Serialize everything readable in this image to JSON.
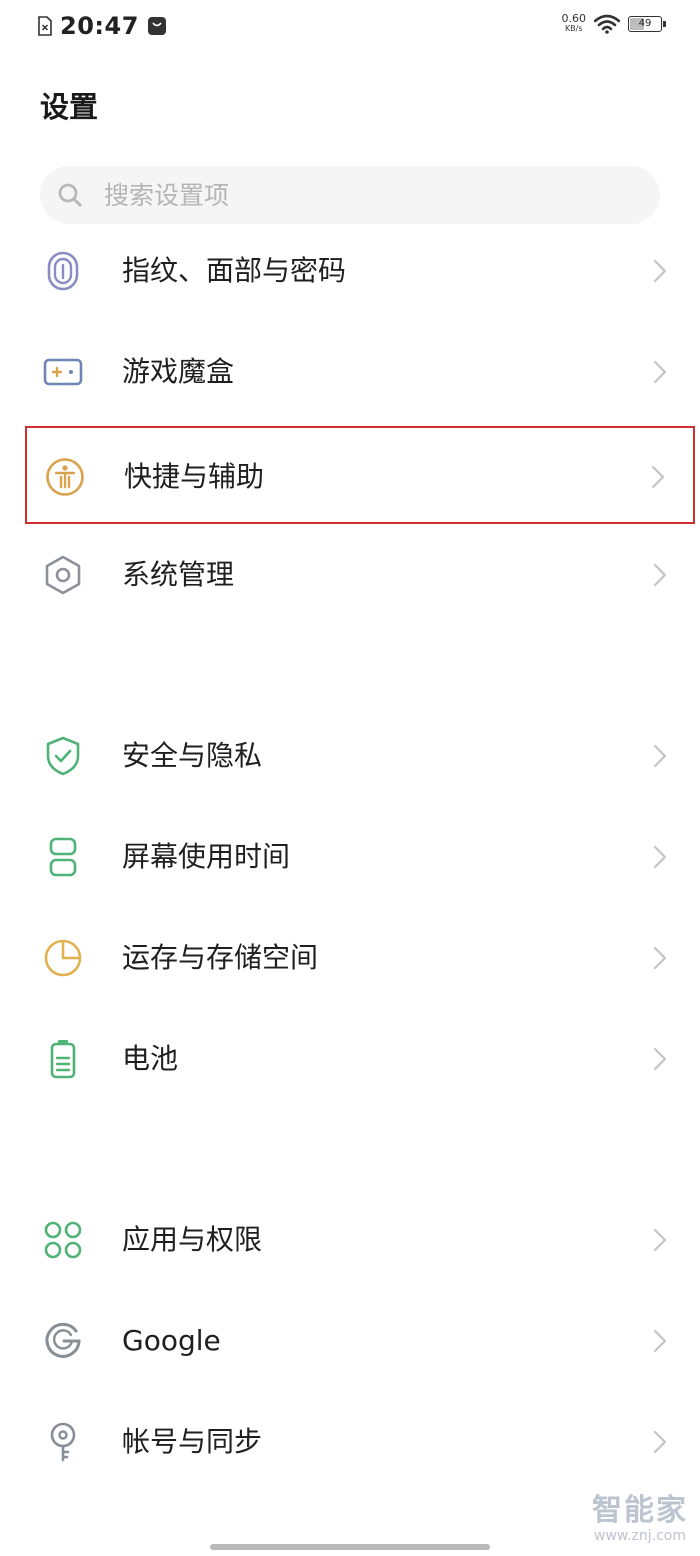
{
  "status_bar": {
    "time": "20:47",
    "net_speed_value": "0.60",
    "net_speed_unit": "KB/s",
    "battery_level": "49",
    "battery_fraction": 0.49
  },
  "header": {
    "title": "设置"
  },
  "search": {
    "placeholder": "搜索设置项"
  },
  "settings_items": [
    {
      "label": "指纹、面部与密码",
      "icon": "fingerprint-icon",
      "color": "#8a8cc4"
    },
    {
      "label": "游戏魔盒",
      "icon": "game-controller-icon",
      "color": "#6f86b3"
    },
    {
      "label": "快捷与辅助",
      "icon": "accessibility-icon",
      "color": "#d9a24b"
    },
    {
      "label": "系统管理",
      "icon": "system-hexagon-icon",
      "color": "#8b9099"
    },
    {
      "label": "安全与隐私",
      "icon": "shield-check-icon",
      "color": "#4fb377"
    },
    {
      "label": "屏幕使用时间",
      "icon": "hourglass-icon",
      "color": "#4fb377"
    },
    {
      "label": "运存与存储空间",
      "icon": "pie-chart-icon",
      "color": "#e0b14e"
    },
    {
      "label": "电池",
      "icon": "battery-icon",
      "color": "#4fb377"
    },
    {
      "label": "应用与权限",
      "icon": "apps-grid-icon",
      "color": "#4fb377"
    },
    {
      "label": "Google",
      "icon": "google-icon",
      "color": "#888e96"
    },
    {
      "label": "帐号与同步",
      "icon": "account-key-icon",
      "color": "#888e96"
    }
  ],
  "highlight_color": "#d0302f",
  "watermark": {
    "name": "智能家",
    "url": "www.znj.com"
  }
}
